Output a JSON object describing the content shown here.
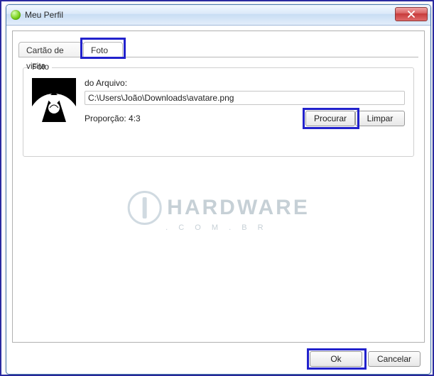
{
  "window": {
    "title": "Meu Perfil"
  },
  "tabs": {
    "card": "Cartão de visita",
    "photo": "Foto"
  },
  "group": {
    "legend": "Foto",
    "file_label": "do Arquivo:",
    "file_path": "C:\\Users\\João\\Downloads\\avatare.png",
    "ratio_label": "Proporção: 4:3",
    "browse": "Procurar",
    "clear": "Limpar"
  },
  "footer": {
    "ok": "Ok",
    "cancel": "Cancelar"
  },
  "watermark": {
    "main": "HARDWARE",
    "sub": ". C O M . B R"
  }
}
